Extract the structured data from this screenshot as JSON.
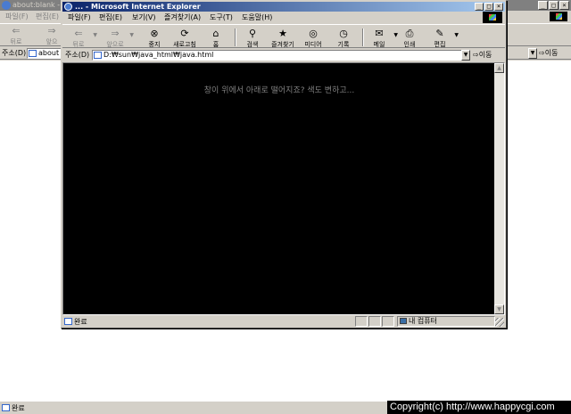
{
  "background_window": {
    "title": "about:blank - M",
    "controls": [
      "_",
      "□",
      "×"
    ],
    "menu": [
      "파일(F)",
      "편집(E)"
    ],
    "toolbar": [
      {
        "label": "뒤로",
        "icon": "back-arrow-icon"
      },
      {
        "label": "앞으",
        "icon": "forward-arrow-icon"
      }
    ],
    "address": {
      "label": "주소(D)",
      "value": "about"
    },
    "go_label": "이동",
    "status": "완료"
  },
  "popup_window": {
    "title": "... - Microsoft Internet Explorer",
    "controls": [
      "_",
      "□",
      "×"
    ],
    "menu": [
      "파일(F)",
      "편집(E)",
      "보기(V)",
      "즐겨찾기(A)",
      "도구(T)",
      "도움말(H)"
    ],
    "toolbar": [
      {
        "label": "뒤로",
        "icon": "back-arrow-icon",
        "glyph": "⇐"
      },
      {
        "label": "앞으로",
        "icon": "forward-arrow-icon",
        "glyph": "⇒"
      },
      {
        "label": "중지",
        "icon": "stop-icon",
        "glyph": "⊗"
      },
      {
        "label": "새로고침",
        "icon": "refresh-icon",
        "glyph": "⟳"
      },
      {
        "label": "홈",
        "icon": "home-icon",
        "glyph": "⌂"
      },
      {
        "label": "검색",
        "icon": "search-icon",
        "glyph": "⚲"
      },
      {
        "label": "즐겨찾기",
        "icon": "favorites-icon",
        "glyph": "★"
      },
      {
        "label": "미디어",
        "icon": "media-icon",
        "glyph": "◎"
      },
      {
        "label": "기록",
        "icon": "history-icon",
        "glyph": "◷"
      },
      {
        "label": "메일",
        "icon": "mail-icon",
        "glyph": "✉"
      },
      {
        "label": "인쇄",
        "icon": "print-icon",
        "glyph": "⎙"
      },
      {
        "label": "편집",
        "icon": "edit-icon",
        "glyph": "✎"
      }
    ],
    "address": {
      "label": "주소(D)",
      "value": "D:₩sun₩java_html₩java.html"
    },
    "go_label": "이동",
    "content_message": "창이 위에서 아래로 떨어지죠? 색도 변하고...",
    "status": "완료",
    "zone": "내 컴퓨터"
  },
  "copyright": "Copyright(c) http://www.happycgi.com",
  "colors": {
    "titlebar_active": "#0a246a",
    "titlebar_inactive": "#808080",
    "content_bg": "#000000",
    "message": "#808080",
    "chrome": "#d4d0c8"
  }
}
